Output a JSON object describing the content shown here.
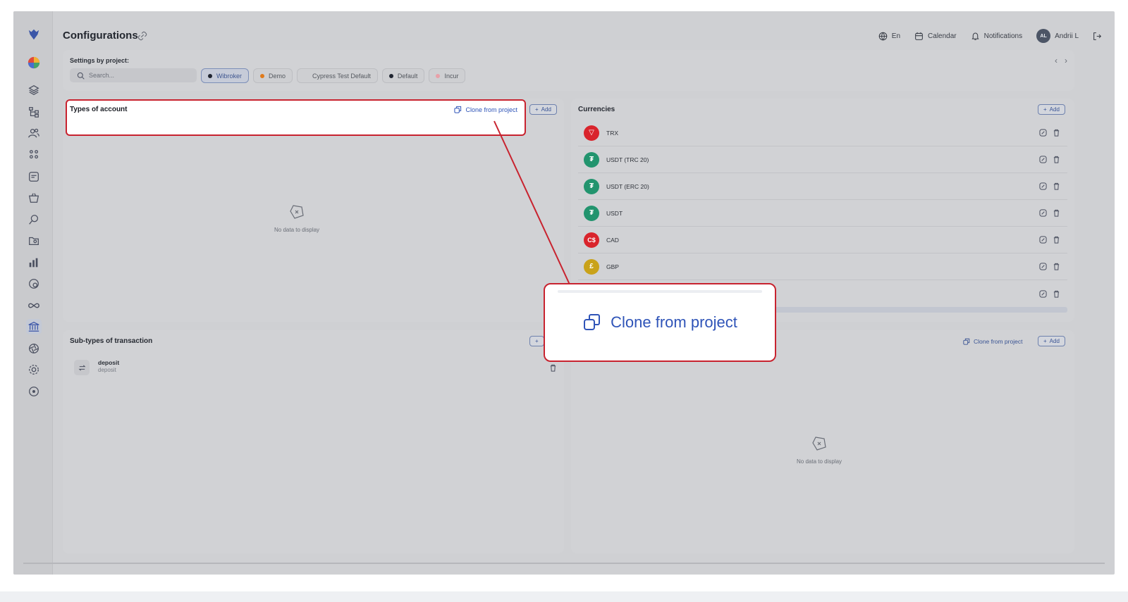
{
  "header": {
    "title": "Configurations",
    "language": "En",
    "calendar": "Calendar",
    "notifications": "Notifications",
    "user_initials": "AL",
    "user_name": "Andrii L"
  },
  "project_bar": {
    "label": "Settings by project:",
    "search_placeholder": "Search...",
    "projects": [
      {
        "name": "Wibroker",
        "dot_color": "#1f2430",
        "selected": true
      },
      {
        "name": "Demo",
        "dot_color": "#e07a1a",
        "selected": false
      },
      {
        "name": "Cypress Test Default",
        "dot_color": "",
        "selected": false
      },
      {
        "name": "Default",
        "dot_color": "#1f2430",
        "selected": false
      },
      {
        "name": "Incur",
        "dot_color": "#e8a0a8",
        "selected": false
      }
    ]
  },
  "types_of_account": {
    "title": "Types of account",
    "clone_label": "Clone from project",
    "add_label": "Add",
    "empty_text": "No data to display"
  },
  "currencies": {
    "title": "Currencies",
    "add_label": "Add",
    "items": [
      {
        "name": "TRX",
        "icon_color": "#d9242c",
        "glyph": "▽"
      },
      {
        "name": "USDT (TRC 20)",
        "icon_color": "#22946e",
        "glyph": "₮"
      },
      {
        "name": "USDT (ERC 20)",
        "icon_color": "#22946e",
        "glyph": "₮"
      },
      {
        "name": "USDT",
        "icon_color": "#22946e",
        "glyph": "₮"
      },
      {
        "name": "CAD",
        "icon_color": "#d9242c",
        "glyph": "C$"
      },
      {
        "name": "GBP",
        "icon_color": "#c9a21a",
        "glyph": "£"
      },
      {
        "name": "",
        "icon_color": "",
        "glyph": ""
      }
    ]
  },
  "sub_types": {
    "title": "Sub-types of transaction",
    "add_label": "+",
    "items": [
      {
        "title": "deposit",
        "subtitle": "deposit"
      }
    ]
  },
  "fourth_card": {
    "clone_label": "Clone from project",
    "add_label": "Add",
    "empty_text": "No data to display"
  },
  "callout": {
    "text": "Clone from project"
  },
  "colors": {
    "accent": "#2f54b8",
    "highlight": "#c8232f"
  }
}
